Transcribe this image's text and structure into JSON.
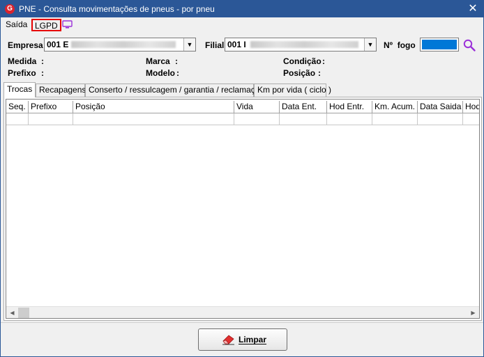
{
  "window": {
    "title": "PNE - Consulta movimentações de pneus - por pneu",
    "close_glyph": "✕",
    "app_icon_letter": "G"
  },
  "menu": {
    "items": [
      {
        "label": "Saída"
      },
      {
        "label": "LGPD"
      }
    ],
    "monitor_icon": "monitor-icon"
  },
  "filters": {
    "empresa_label": "Empresa",
    "empresa_value": "001 E",
    "filial_label": "Filial",
    "filial_value": "001 I",
    "fogo_label": "Nº  fogo"
  },
  "info": {
    "medida_label": "Medida",
    "prefixo_label": "Prefixo",
    "marca_label": "Marca",
    "modelo_label": "Modelo",
    "condicao_label": "Condição",
    "posicao_label": "Posição",
    "colon": ":"
  },
  "tabs": [
    {
      "label": "Trocas",
      "active": true
    },
    {
      "label": "Recapagens",
      "active": false
    },
    {
      "label": "Conserto / ressulcagem / garantia / reclamação",
      "active": false
    },
    {
      "label": "Km por vida ( ciclo )",
      "active": false
    }
  ],
  "table": {
    "columns": [
      "Seq.",
      "Prefixo",
      "Posição",
      "Vida",
      "Data Ent.",
      "Hod Entr.",
      "Km. Acum. E",
      "Data Saida",
      "Hod"
    ]
  },
  "buttons": {
    "limpar_label": "Limpar"
  },
  "colors": {
    "title_bar": "#2b5797",
    "highlight": "#e60000",
    "fogo_fill": "#0078d7",
    "accent_purple": "#9b30d9"
  }
}
